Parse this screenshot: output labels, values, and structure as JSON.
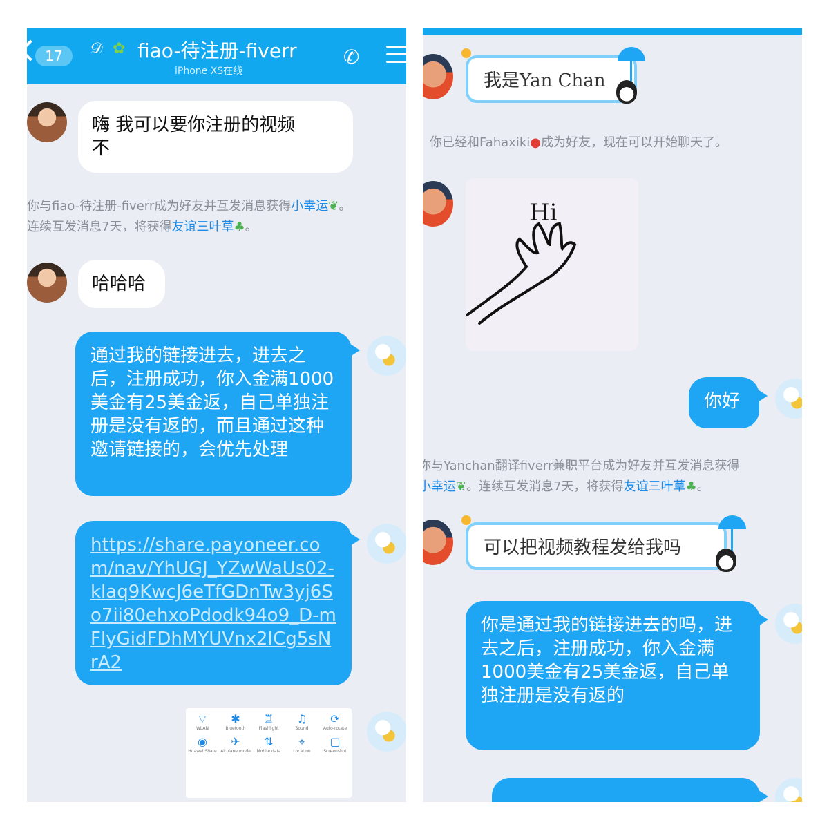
{
  "left": {
    "header": {
      "unread_count": "17",
      "title": "fiao-待注册-fiverr",
      "subtitle": "iPhone XS在线"
    },
    "messages": [
      {
        "type": "in",
        "text": "嗨 我可以要你注册的视频\n不"
      },
      {
        "type": "sys",
        "line1_a": "你与fiao-待注册-fiverr成为好友并互发消息获得",
        "line1_link": "小幸运",
        "line1_b": "。",
        "line2_a": "连续互发消息7天，将获得",
        "line2_link": "友谊三叶草",
        "line2_b": "。"
      },
      {
        "type": "in",
        "text": "哈哈哈"
      },
      {
        "type": "out",
        "text": "通过我的链接进去，进去之后，注册成功，你入金满1000美金有25美金返，自己单独注册是没有返的，而且通过这种邀请链接的，会优先处理"
      },
      {
        "type": "out_link",
        "text": "https://share.payoneer.com/nav/YhUGJ_YZwWaUs02-klaq9KwcJ6eTfGDnTw3yj6So7ii80ehxoPdodk94o9_D-mFlyGidFDhMYUVnx2ICg5sNrA2"
      }
    ],
    "screenshot_tiles": [
      {
        "glyph": "⌔",
        "label": "WLAN"
      },
      {
        "glyph": "✱",
        "label": "Bluetooth"
      },
      {
        "glyph": "♖",
        "label": "Flashlight"
      },
      {
        "glyph": "♫",
        "label": "Sound"
      },
      {
        "glyph": "⟳",
        "label": "Auto-rotate"
      }
    ],
    "screenshot_tiles_row2": [
      {
        "glyph": "◉",
        "label": "Huawei Share"
      },
      {
        "glyph": "✈",
        "label": "Airplane mode"
      },
      {
        "glyph": "⇅",
        "label": "Mobile data"
      },
      {
        "glyph": "⌖",
        "label": "Location"
      },
      {
        "glyph": "▢",
        "label": "Screenshot"
      }
    ]
  },
  "right": {
    "messages": [
      {
        "type": "sticker",
        "text": "我是Yan Chan"
      },
      {
        "type": "sys",
        "text_a": "你已经和Fahaxiki",
        "text_b": "成为好友，现在可以开始聊天了。"
      },
      {
        "type": "image",
        "text": "Hi"
      },
      {
        "type": "out",
        "text": "你好"
      },
      {
        "type": "sys2",
        "line1": "你与Yanchan翻译fiverr兼职平台成为好友并互发消息获得",
        "line2_link1": "小幸运",
        "line2_a": "。连续互发消息7天，将获得",
        "line2_link2": "友谊三叶草",
        "line2_b": "。"
      },
      {
        "type": "sticker",
        "text": "可以把视频教程发给我吗"
      },
      {
        "type": "out",
        "text": "你是通过我的链接进去的吗，进去之后，注册成功，你入金满1000美金有25美金返，自己单独注册是没有返的"
      }
    ]
  },
  "colors": {
    "header_blue": "#12a8f0",
    "bubble_out": "#1ea6f5",
    "chat_bg": "#eaedf4",
    "link_blue": "#1a8be8"
  }
}
